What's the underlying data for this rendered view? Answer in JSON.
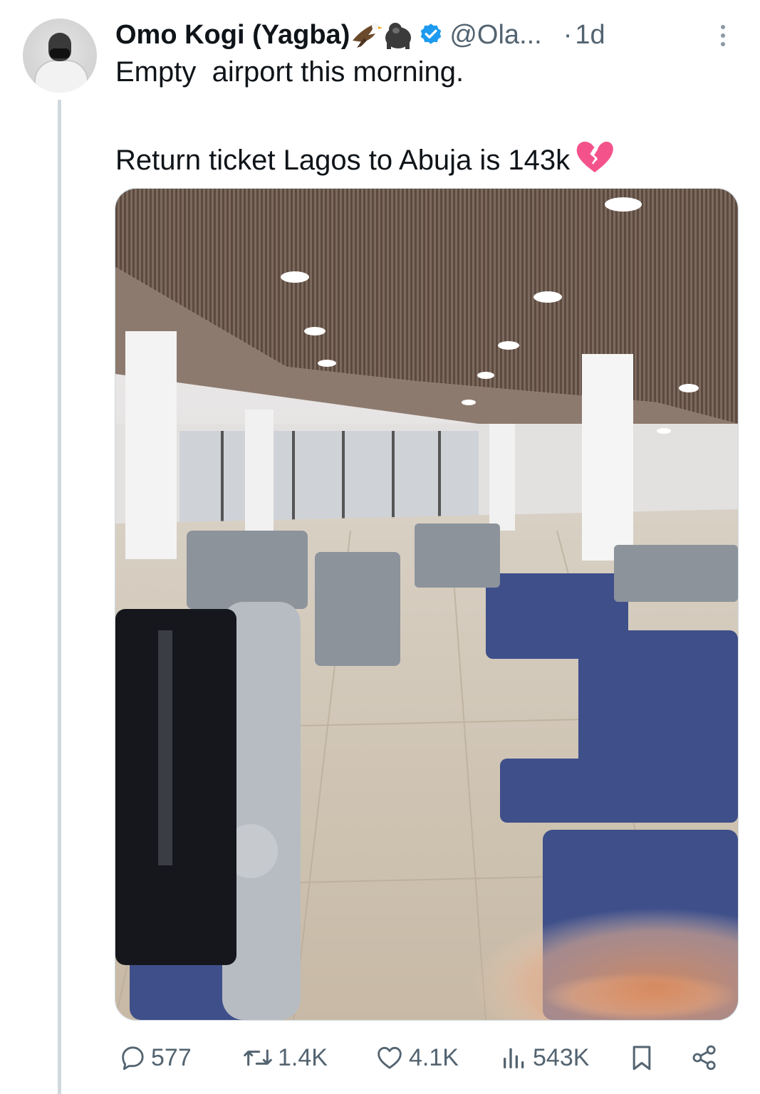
{
  "tweet": {
    "author": {
      "display_name": "Omo Kogi (Yagba)",
      "name_emojis": [
        "eagle-emoji",
        "gorilla-emoji"
      ],
      "verified": true,
      "handle": "@Ola...",
      "time_separator": "·",
      "time": "1d"
    },
    "text_line1": "Empty  airport this morning.",
    "text_line2": "Return ticket Lagos to Abuja is 143k",
    "text_emoji": "broken-heart-emoji",
    "media": {
      "kind": "photo",
      "subject": "airport departure lounge with empty blue seats"
    },
    "metrics": {
      "replies": "577",
      "reposts": "1.4K",
      "likes": "4.1K",
      "views": "543K"
    },
    "colors": {
      "text": "#0f1419",
      "secondary": "#536471",
      "verified": "#1d9bf0",
      "thread_line": "#cfd9de",
      "broken_heart": "#f4528b"
    }
  }
}
